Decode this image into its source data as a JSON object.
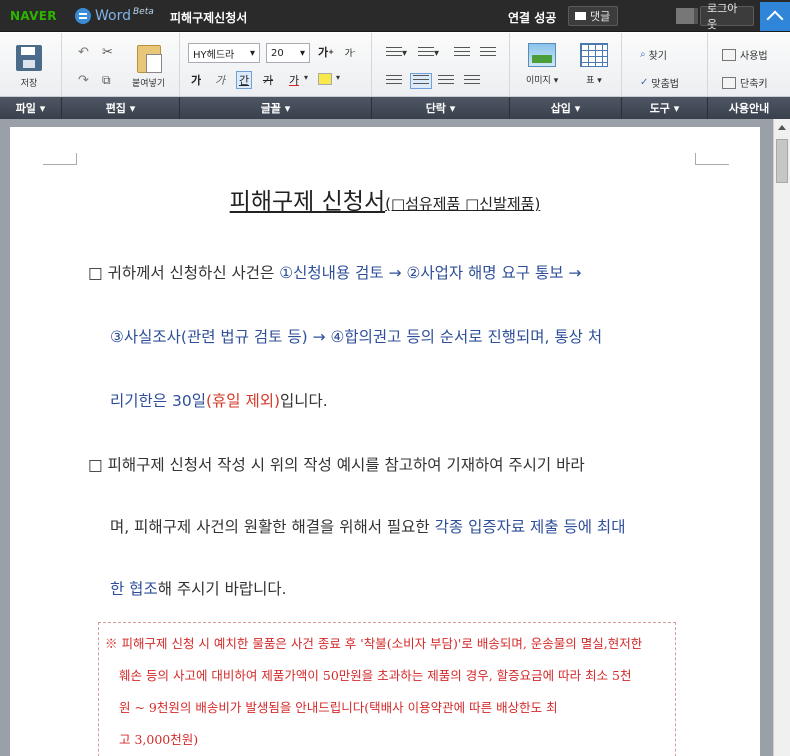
{
  "titlebar": {
    "brand": "NAVER",
    "app_name": "Word",
    "app_beta": "Beta",
    "doc_title": "피해구제신청서",
    "status": "연결 성공",
    "comment_label": "댓글",
    "logout_label": "로그아웃"
  },
  "ribbon": {
    "save_label": "저장",
    "paste_label": "붙여넣기",
    "font_name": "HY헤드라",
    "font_size": "20",
    "image_label": "이미지",
    "table_label": "표",
    "find_label": "찾기",
    "spell_label": "맞춤법",
    "help_label": "사용법",
    "shortcut_label": "단축키",
    "format_glyphs": [
      "가",
      "가",
      "간",
      "가",
      "가"
    ]
  },
  "groups": [
    "파일",
    "편집",
    "글꼴",
    "단락",
    "삽입",
    "도구",
    "사용안내"
  ],
  "document": {
    "title_main": "피해구제 신청서",
    "title_sub": "(□섬유제품 □신발제품)",
    "p1": {
      "l1_a": "□ 귀하께서 신청하신 사건은 ",
      "l1_b": "①신청내용 검토 → ②사업자 해명 요구 통보 →",
      "l2": "③사실조사(관련 법규 검토 등) → ④합의권고 등의 순서로 진행되며, 통상 처",
      "l3_a": "리기한은 30일",
      "l3_b": "(휴일 제외)",
      "l3_c": "입니다."
    },
    "p2": {
      "l1": "□ 피해구제 신청서 작성 시 위의 작성 예시를 참고하여 기재하여 주시기 바라",
      "l2_a": "며, 피해구제 사건의 원활한 해결을 위해서 필요한 ",
      "l2_b": "각종 입증자료 제출 등에 최대",
      "l3_a": "한 협조",
      "l3_b": "해 주시기 바랍니다."
    },
    "note": {
      "l1": "※ 피해구제 신청 시 예치한 물품은 사건 종료 후 '착불(소비자 부담)'로 배송되며, 운송물의 멸실,현저한",
      "l2": "훼손 등의 사고에 대비하여 제품가액이 50만원을 초과하는 제품의 경우, 할증요금에 따라 최소 5천",
      "l3": "원 ~ 9천원의 배송비가 발생됨을 안내드립니다(택배사 이용약관에 따른 배상한도 최",
      "l4": "고 3,000천원)"
    }
  }
}
